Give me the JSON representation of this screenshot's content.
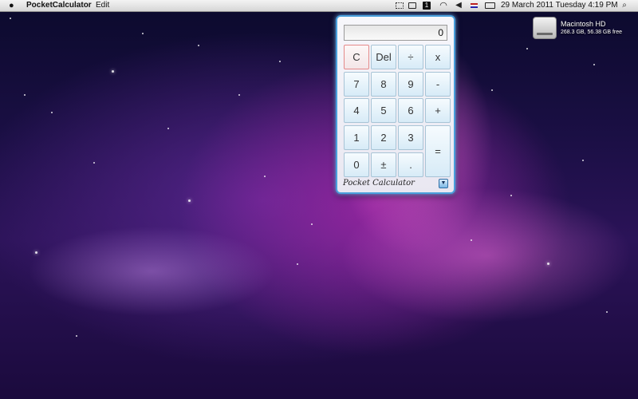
{
  "menubar": {
    "apple_icon": "apple-logo",
    "app_name": "PocketCalculator",
    "edit": "Edit",
    "datetime": "29 March 2011 Tuesday 4:19 PM",
    "input_menu_badge": "1",
    "search_icon": "search-icon"
  },
  "desktop": {
    "drive_name": "Macintosh HD",
    "drive_info": "268.3 GB, 56.38 GB free"
  },
  "calculator": {
    "display": "0",
    "keys": {
      "clear": "C",
      "del": "Del",
      "divide": "÷",
      "multiply": "x",
      "seven": "7",
      "eight": "8",
      "nine": "9",
      "minus": "-",
      "four": "4",
      "five": "5",
      "six": "6",
      "plus": "+",
      "one": "1",
      "two": "2",
      "three": "3",
      "equals": "=",
      "zero": "0",
      "plusminus": "±",
      "dot": "."
    },
    "brand": "Pocket Calculator",
    "menu_arrow": "▼"
  }
}
